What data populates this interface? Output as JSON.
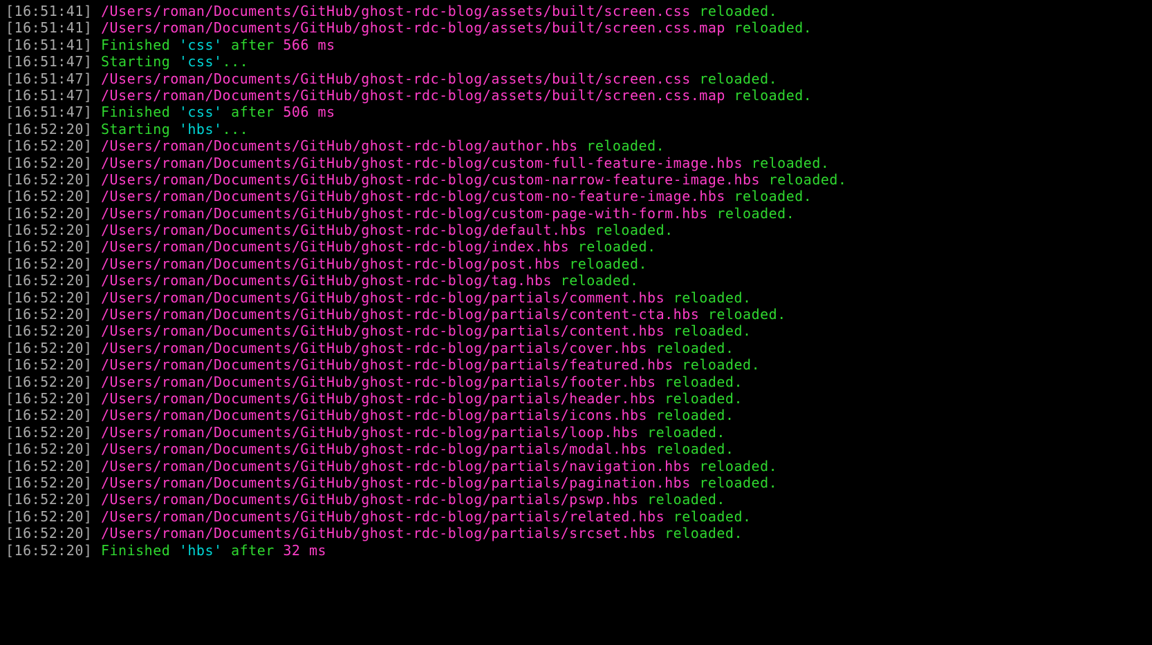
{
  "lines": [
    {
      "type": "reload",
      "time": "16:51:41",
      "path": "/Users/roman/Documents/GitHub/ghost-rdc-blog/assets/built/screen.css",
      "status": "reloaded."
    },
    {
      "type": "reload",
      "time": "16:51:41",
      "path": "/Users/roman/Documents/GitHub/ghost-rdc-blog/assets/built/screen.css.map",
      "status": "reloaded."
    },
    {
      "type": "finished",
      "time": "16:51:41",
      "word": "Finished",
      "task": "'css'",
      "after": "after",
      "duration": "566 ms"
    },
    {
      "type": "starting",
      "time": "16:51:47",
      "word": "Starting",
      "task": "'css'",
      "dots": "..."
    },
    {
      "type": "reload",
      "time": "16:51:47",
      "path": "/Users/roman/Documents/GitHub/ghost-rdc-blog/assets/built/screen.css",
      "status": "reloaded."
    },
    {
      "type": "reload",
      "time": "16:51:47",
      "path": "/Users/roman/Documents/GitHub/ghost-rdc-blog/assets/built/screen.css.map",
      "status": "reloaded."
    },
    {
      "type": "finished",
      "time": "16:51:47",
      "word": "Finished",
      "task": "'css'",
      "after": "after",
      "duration": "506 ms"
    },
    {
      "type": "starting",
      "time": "16:52:20",
      "word": "Starting",
      "task": "'hbs'",
      "dots": "..."
    },
    {
      "type": "reload",
      "time": "16:52:20",
      "path": "/Users/roman/Documents/GitHub/ghost-rdc-blog/author.hbs",
      "status": "reloaded."
    },
    {
      "type": "reload",
      "time": "16:52:20",
      "path": "/Users/roman/Documents/GitHub/ghost-rdc-blog/custom-full-feature-image.hbs",
      "status": "reloaded."
    },
    {
      "type": "reload",
      "time": "16:52:20",
      "path": "/Users/roman/Documents/GitHub/ghost-rdc-blog/custom-narrow-feature-image.hbs",
      "status": "reloaded."
    },
    {
      "type": "reload",
      "time": "16:52:20",
      "path": "/Users/roman/Documents/GitHub/ghost-rdc-blog/custom-no-feature-image.hbs",
      "status": "reloaded."
    },
    {
      "type": "reload",
      "time": "16:52:20",
      "path": "/Users/roman/Documents/GitHub/ghost-rdc-blog/custom-page-with-form.hbs",
      "status": "reloaded."
    },
    {
      "type": "reload",
      "time": "16:52:20",
      "path": "/Users/roman/Documents/GitHub/ghost-rdc-blog/default.hbs",
      "status": "reloaded."
    },
    {
      "type": "reload",
      "time": "16:52:20",
      "path": "/Users/roman/Documents/GitHub/ghost-rdc-blog/index.hbs",
      "status": "reloaded."
    },
    {
      "type": "reload",
      "time": "16:52:20",
      "path": "/Users/roman/Documents/GitHub/ghost-rdc-blog/post.hbs",
      "status": "reloaded."
    },
    {
      "type": "reload",
      "time": "16:52:20",
      "path": "/Users/roman/Documents/GitHub/ghost-rdc-blog/tag.hbs",
      "status": "reloaded."
    },
    {
      "type": "reload",
      "time": "16:52:20",
      "path": "/Users/roman/Documents/GitHub/ghost-rdc-blog/partials/comment.hbs",
      "status": "reloaded."
    },
    {
      "type": "reload",
      "time": "16:52:20",
      "path": "/Users/roman/Documents/GitHub/ghost-rdc-blog/partials/content-cta.hbs",
      "status": "reloaded."
    },
    {
      "type": "reload",
      "time": "16:52:20",
      "path": "/Users/roman/Documents/GitHub/ghost-rdc-blog/partials/content.hbs",
      "status": "reloaded."
    },
    {
      "type": "reload",
      "time": "16:52:20",
      "path": "/Users/roman/Documents/GitHub/ghost-rdc-blog/partials/cover.hbs",
      "status": "reloaded."
    },
    {
      "type": "reload",
      "time": "16:52:20",
      "path": "/Users/roman/Documents/GitHub/ghost-rdc-blog/partials/featured.hbs",
      "status": "reloaded."
    },
    {
      "type": "reload",
      "time": "16:52:20",
      "path": "/Users/roman/Documents/GitHub/ghost-rdc-blog/partials/footer.hbs",
      "status": "reloaded."
    },
    {
      "type": "reload",
      "time": "16:52:20",
      "path": "/Users/roman/Documents/GitHub/ghost-rdc-blog/partials/header.hbs",
      "status": "reloaded."
    },
    {
      "type": "reload",
      "time": "16:52:20",
      "path": "/Users/roman/Documents/GitHub/ghost-rdc-blog/partials/icons.hbs",
      "status": "reloaded."
    },
    {
      "type": "reload",
      "time": "16:52:20",
      "path": "/Users/roman/Documents/GitHub/ghost-rdc-blog/partials/loop.hbs",
      "status": "reloaded."
    },
    {
      "type": "reload",
      "time": "16:52:20",
      "path": "/Users/roman/Documents/GitHub/ghost-rdc-blog/partials/modal.hbs",
      "status": "reloaded."
    },
    {
      "type": "reload",
      "time": "16:52:20",
      "path": "/Users/roman/Documents/GitHub/ghost-rdc-blog/partials/navigation.hbs",
      "status": "reloaded."
    },
    {
      "type": "reload",
      "time": "16:52:20",
      "path": "/Users/roman/Documents/GitHub/ghost-rdc-blog/partials/pagination.hbs",
      "status": "reloaded."
    },
    {
      "type": "reload",
      "time": "16:52:20",
      "path": "/Users/roman/Documents/GitHub/ghost-rdc-blog/partials/pswp.hbs",
      "status": "reloaded."
    },
    {
      "type": "reload",
      "time": "16:52:20",
      "path": "/Users/roman/Documents/GitHub/ghost-rdc-blog/partials/related.hbs",
      "status": "reloaded."
    },
    {
      "type": "reload",
      "time": "16:52:20",
      "path": "/Users/roman/Documents/GitHub/ghost-rdc-blog/partials/srcset.hbs",
      "status": "reloaded."
    },
    {
      "type": "finished",
      "time": "16:52:20",
      "word": "Finished",
      "task": "'hbs'",
      "after": "after",
      "duration": "32 ms"
    }
  ]
}
